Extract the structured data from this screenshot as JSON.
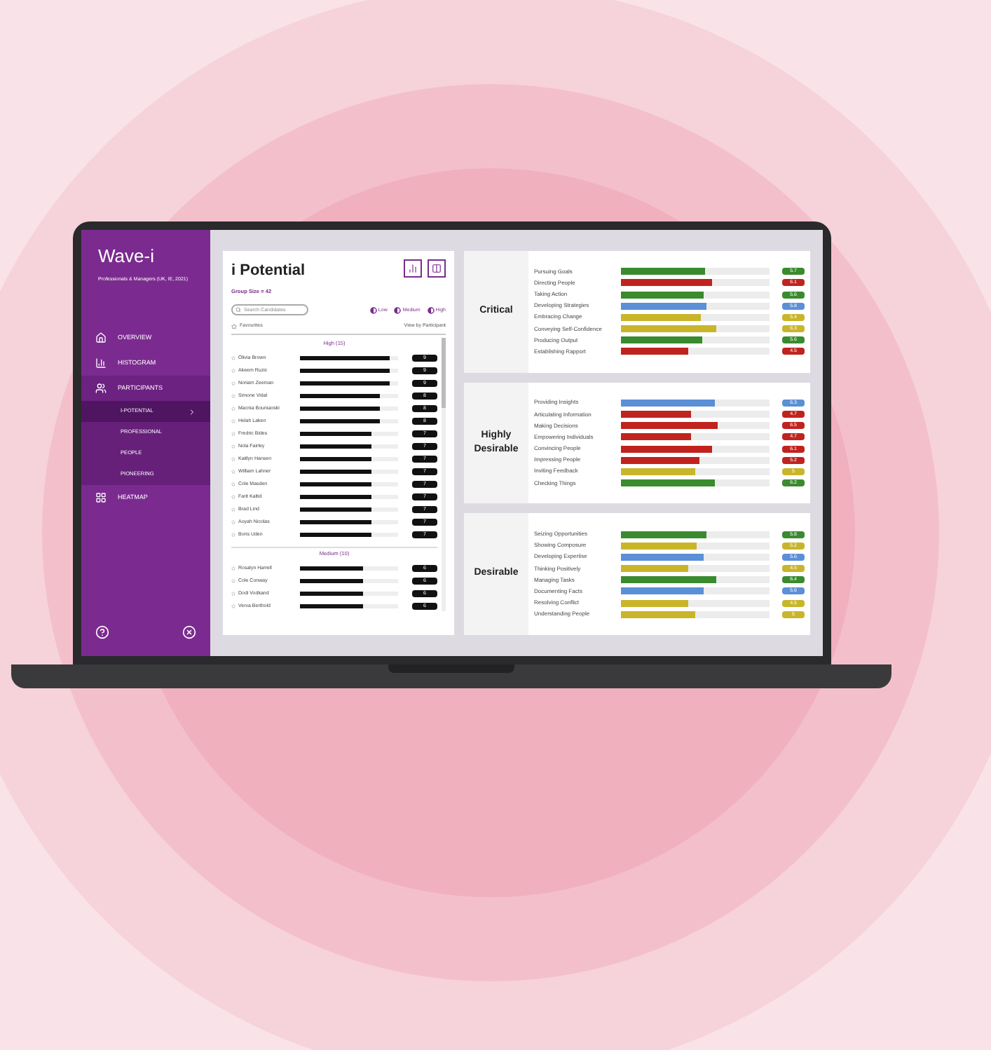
{
  "sidebar": {
    "title": "Wave-i",
    "subtitle": "Professionals & Managers (UK, IE, 2021)",
    "items": [
      {
        "label": "OVERVIEW",
        "kind": "home",
        "selected": false
      },
      {
        "label": "HISTOGRAM",
        "kind": "bars",
        "selected": false
      },
      {
        "label": "PARTICIPANTS",
        "kind": "people",
        "selected": true,
        "expanded": true,
        "children": [
          {
            "label": "I-POTENTIAL",
            "selected": true
          },
          {
            "label": "PROFESSIONAL",
            "selected": false
          },
          {
            "label": "PEOPLE",
            "selected": false
          },
          {
            "label": "PIONEERING",
            "selected": false
          }
        ]
      },
      {
        "label": "HEATMAP",
        "kind": "heatmap",
        "selected": false
      }
    ]
  },
  "panel": {
    "title": "i Potential",
    "group_size": "Group Size = 42",
    "search": {
      "placeholder": "Search Candidates"
    },
    "filters": [
      "Low",
      "Medium",
      "High"
    ],
    "favourites": "Favourites",
    "view_by": "View by Participant",
    "groups": [
      {
        "label": "High (15)",
        "rows": [
          {
            "name": "Olivia Brown",
            "level": 0.91,
            "score": "9"
          },
          {
            "name": "Akeem Ruzic",
            "level": 0.91,
            "score": "9"
          },
          {
            "name": "Noriam Zeeman",
            "level": 0.91,
            "score": "9"
          },
          {
            "name": "Simone Vidal",
            "level": 0.82,
            "score": "8"
          },
          {
            "name": "Macnia Bouniaoski",
            "level": 0.82,
            "score": "8"
          },
          {
            "name": "Helah Laken",
            "level": 0.82,
            "score": "8"
          },
          {
            "name": "Fredric Bides",
            "level": 0.73,
            "score": "7"
          },
          {
            "name": "Nola Fairley",
            "level": 0.73,
            "score": "7"
          },
          {
            "name": "Kaitlyn Hansen",
            "level": 0.73,
            "score": "7"
          },
          {
            "name": "William Lahner",
            "level": 0.73,
            "score": "7"
          },
          {
            "name": "Cole Masden",
            "level": 0.73,
            "score": "7"
          },
          {
            "name": "Farit Kaltid",
            "level": 0.73,
            "score": "7"
          },
          {
            "name": "Brad Lind",
            "level": 0.73,
            "score": "7"
          },
          {
            "name": "Aoyah Nicolas",
            "level": 0.73,
            "score": "7"
          },
          {
            "name": "Boris Uden",
            "level": 0.73,
            "score": "7"
          }
        ]
      },
      {
        "label": "Medium (10)",
        "rows": [
          {
            "name": "Rosalyn Harrell",
            "level": 0.64,
            "score": "6"
          },
          {
            "name": "Cole Conway",
            "level": 0.64,
            "score": "6"
          },
          {
            "name": "Dodi Vodkand",
            "level": 0.64,
            "score": "6"
          },
          {
            "name": "Verva Berthold",
            "level": 0.64,
            "score": "6"
          }
        ]
      }
    ]
  },
  "cards": [
    {
      "title": "Critical",
      "rows": [
        {
          "label": "Pursuing Goals",
          "color": "#3a8a2e",
          "level": 0.57,
          "reading": "5.7"
        },
        {
          "label": "Directing People",
          "color": "#c0231e",
          "level": 0.61,
          "reading": "6.1"
        },
        {
          "label": "Taking Action",
          "color": "#3a8a2e",
          "level": 0.56,
          "reading": "5.6"
        },
        {
          "label": "Developing Strategies",
          "color": "#5b8fd6",
          "level": 0.58,
          "reading": "5.8"
        },
        {
          "label": "Embracing Change",
          "color": "#c9b52a",
          "level": 0.54,
          "reading": "5.4"
        },
        {
          "label": "Conveying Self-Confidence",
          "color": "#c9b52a",
          "level": 0.64,
          "reading": "6.3"
        },
        {
          "label": "Producing Output",
          "color": "#3a8a2e",
          "level": 0.55,
          "reading": "5.6"
        },
        {
          "label": "Establishing Rapport",
          "color": "#c0231e",
          "level": 0.45,
          "reading": "4.5"
        }
      ]
    },
    {
      "title": "Highly Desirable",
      "rows": [
        {
          "label": "Providing Insights",
          "color": "#5b8fd6",
          "level": 0.63,
          "reading": "6.3"
        },
        {
          "label": "Articulating Information",
          "color": "#c0231e",
          "level": 0.47,
          "reading": "4.7"
        },
        {
          "label": "Making Decisions",
          "color": "#c0231e",
          "level": 0.65,
          "reading": "6.5"
        },
        {
          "label": "Empowering Individuals",
          "color": "#c0231e",
          "level": 0.47,
          "reading": "4.7"
        },
        {
          "label": "Convincing People",
          "color": "#c0231e",
          "level": 0.61,
          "reading": "6.1"
        },
        {
          "label": "Impressing People",
          "color": "#c0231e",
          "level": 0.53,
          "reading": "5.2"
        },
        {
          "label": "Inviting Feedback",
          "color": "#c9b52a",
          "level": 0.5,
          "reading": "5"
        },
        {
          "label": "Checking Things",
          "color": "#3a8a2e",
          "level": 0.63,
          "reading": "6.2"
        }
      ]
    },
    {
      "title": "Desirable",
      "rows": [
        {
          "label": "Seizing Opportunities",
          "color": "#3a8a2e",
          "level": 0.58,
          "reading": "5.8"
        },
        {
          "label": "Showing Composure",
          "color": "#c9b52a",
          "level": 0.51,
          "reading": "5.2"
        },
        {
          "label": "Developing Expertise",
          "color": "#5b8fd6",
          "level": 0.56,
          "reading": "5.6"
        },
        {
          "label": "Thinking Positively",
          "color": "#c9b52a",
          "level": 0.45,
          "reading": "4.5"
        },
        {
          "label": "Managing Tasks",
          "color": "#3a8a2e",
          "level": 0.64,
          "reading": "6.4"
        },
        {
          "label": "Documenting Facts",
          "color": "#5b8fd6",
          "level": 0.56,
          "reading": "5.6"
        },
        {
          "label": "Resolving Conflict",
          "color": "#c9b52a",
          "level": 0.45,
          "reading": "4.5"
        },
        {
          "label": "Understanding People",
          "color": "#c9b52a",
          "level": 0.5,
          "reading": "5"
        }
      ]
    }
  ]
}
